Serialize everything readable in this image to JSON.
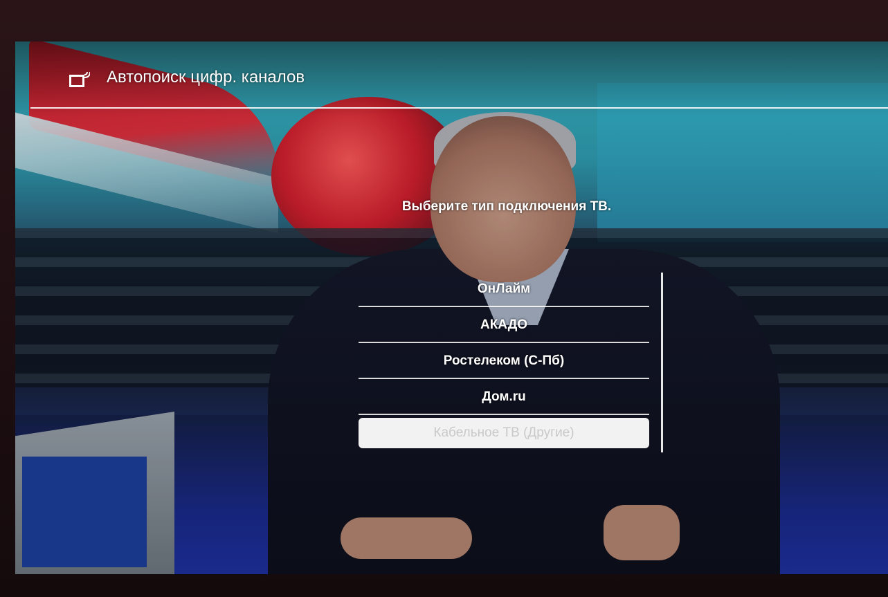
{
  "osd": {
    "title": "Автопоиск цифр. каналов",
    "icon": "tv-antenna-icon",
    "prompt": "Выберите тип подключения ТВ.",
    "options": [
      "ОнЛайм",
      "АКАДО",
      "Ростелеком (С-Пб)",
      "Дом.ru",
      "Кабельное ТВ (Другие)"
    ],
    "selected_index": 4
  },
  "colors": {
    "text": "#ffffff",
    "selected_background": "#f2f2f2",
    "selected_text": "#c9c9c9"
  }
}
